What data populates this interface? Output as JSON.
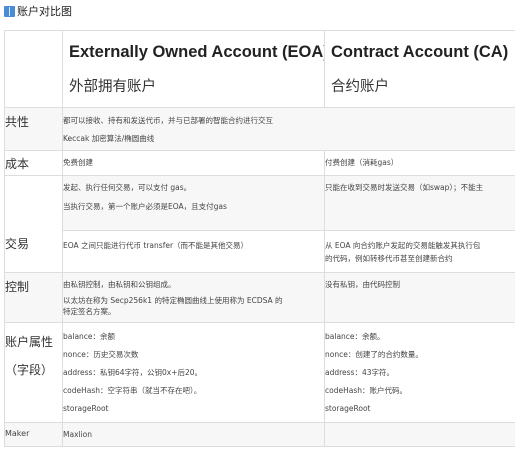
{
  "heading": {
    "icon": "book-icon",
    "text": "账户对比图"
  },
  "header": {
    "eoa_en": "Externally Owned Account (EOA)",
    "eoa_cn": "外部拥有账户",
    "ca_en": "Contract Account (CA)",
    "ca_cn": "合约账户"
  },
  "rows": {
    "common": {
      "label": "共性",
      "lines": [
        "都可以接收、持有和发送代币，并与已部署的智能合约进行交互",
        "Keccak 加密算法/椭圆曲线"
      ]
    },
    "cost": {
      "label": "成本",
      "eoa": "免费创建",
      "ca": "付费创建（消耗gas）"
    },
    "trade": {
      "label": "交易",
      "eoa1": [
        "发起、执行任何交易，可以支付 gas。",
        "当执行交易，第一个账户必须是EOA，且支付gas"
      ],
      "ca1": [
        "只能在收到交易时发送交易（如swap）；不能主"
      ],
      "eoa2": [
        "EOA 之间只能进行代币 transfer（而不能是其他交易）"
      ],
      "ca2": [
        "从 EOA 向合约账户发起的交易能触发其执行包",
        "的代码，例如转移代币甚至创建新合约"
      ]
    },
    "control": {
      "label": "控制",
      "eoa": [
        "由私钥控制，由私钥和公钥组成。",
        "以太坊在称为 Secp256k1 的特定椭圆曲线上使用称为 ECDSA 的",
        "特定签名方案。"
      ],
      "ca": [
        "没有私钥，由代码控制"
      ]
    },
    "props": {
      "label1": "账户属性",
      "label2": "（字段）",
      "eoa": [
        "balance：余额",
        "nonce：历史交易次数",
        "address：私钥64字符，公钥0x+后20。",
        "codeHash：空字符串（就当不存在吧）。",
        "storageRoot"
      ],
      "ca": [
        "balance：余额。",
        "nonce：创建了的合约数量。",
        "address：43字符。",
        "codeHash：账户代码。",
        "storageRoot"
      ]
    },
    "maker": {
      "label": "Maker",
      "value": "Maxlion"
    }
  }
}
